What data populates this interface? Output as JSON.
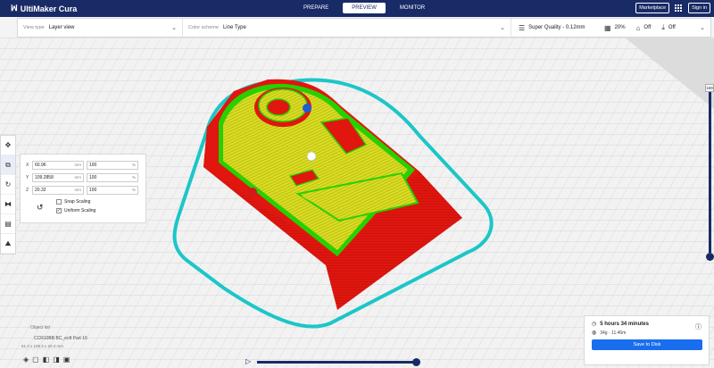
{
  "app": {
    "logo_text": "UltiMaker Cura"
  },
  "stages": [
    "PREPARE",
    "PREVIEW",
    "MONITOR"
  ],
  "top_right": {
    "marketplace": "Marketplace",
    "signin": "Sign in"
  },
  "header": {
    "view_type_label": "View type",
    "view_type_value": "Layer view",
    "color_scheme_label": "Color scheme",
    "color_scheme_value": "Line Type",
    "profile": "Super Quality - 0.12mm",
    "infill": "20%",
    "support": "Off",
    "adhesion": "Off"
  },
  "scale": {
    "x_label": "X",
    "x_mm": "60.96",
    "x_pct": "100",
    "y_label": "Y",
    "y_mm": "109.2858",
    "y_pct": "100",
    "z_label": "Z",
    "z_mm": "20.32",
    "z_pct": "100",
    "unit_mm": "mm",
    "unit_pct": "%",
    "snap_label": "Snap Scaling",
    "uniform_label": "Uniform Scaling"
  },
  "layer": {
    "top_value": "169"
  },
  "object": {
    "list_label": "Object list",
    "name": "CCR10BB BC_ecft Part 16",
    "dims": "61.0 x 109.3 x 20.3 mm"
  },
  "estimate": {
    "time": "5 hours 34 minutes",
    "material": "34g · 11.46m",
    "save_label": "Save to Disk"
  },
  "colors": {
    "topbar": "#192b66",
    "save": "#196ef0",
    "wall_outer": "#dd1a12",
    "wall_inner": "#27d000",
    "skin": "#d9dc22",
    "skirt": "#1cc6c8"
  }
}
